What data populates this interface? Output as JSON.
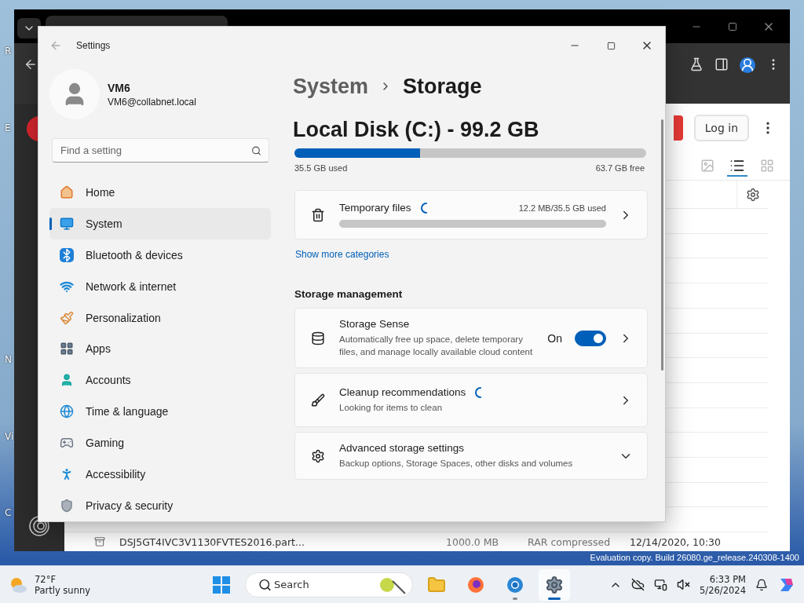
{
  "desktop": {
    "icon_labels": [
      "R",
      "E",
      "N",
      "Vi",
      "C"
    ],
    "build_text": "Evaluation copy. Build 26080.ge_release.240308-1400"
  },
  "browser": {
    "login_button": "Log in",
    "views": [
      {
        "kind": "thumbnail",
        "selected": false
      },
      {
        "kind": "list",
        "selected": true
      },
      {
        "kind": "grid",
        "selected": false
      }
    ],
    "file_row": {
      "name": "DSJ5GT4IVC3V1130FVTES2016.part...",
      "size": "1000.0 MB",
      "type": "RAR compressed",
      "date": "12/14/2020, 10:30"
    }
  },
  "settings": {
    "title": "Settings",
    "user": {
      "name": "VM6",
      "email": "VM6@collabnet.local"
    },
    "search": {
      "placeholder": "Find a setting"
    },
    "nav": [
      {
        "kind": "home",
        "label": "Home",
        "selected": false
      },
      {
        "kind": "system",
        "label": "System",
        "selected": true
      },
      {
        "kind": "bluetooth",
        "label": "Bluetooth & devices",
        "selected": false
      },
      {
        "kind": "network",
        "label": "Network & internet",
        "selected": false
      },
      {
        "kind": "personalization",
        "label": "Personalization",
        "selected": false
      },
      {
        "kind": "apps",
        "label": "Apps",
        "selected": false
      },
      {
        "kind": "accounts",
        "label": "Accounts",
        "selected": false
      },
      {
        "kind": "time",
        "label": "Time & language",
        "selected": false
      },
      {
        "kind": "gaming",
        "label": "Gaming",
        "selected": false
      },
      {
        "kind": "accessibility",
        "label": "Accessibility",
        "selected": false
      },
      {
        "kind": "privacy",
        "label": "Privacy & security",
        "selected": false
      }
    ],
    "breadcrumb": [
      "System",
      "Storage"
    ],
    "disk": {
      "title": "Local Disk (C:) - 99.2 GB",
      "level": 0.358,
      "used": "35.5 GB used",
      "free": "63.7 GB free"
    },
    "temp_files": {
      "label": "Temporary files",
      "loading": true,
      "usage": "12.2 MB/35.5 GB used",
      "level": 0
    },
    "more_link": "Show more categories",
    "section_title": "Storage management",
    "cards": [
      {
        "kind": "toggle",
        "title": "Storage Sense",
        "loading": false,
        "description": "Automatically free up space, delete temporary files, and manage locally available cloud content",
        "state_label": "On",
        "on": true
      },
      {
        "kind": "link",
        "title": "Cleanup recommendations",
        "loading": true,
        "description": "Looking for items to clean"
      },
      {
        "kind": "expander",
        "title": "Advanced storage settings",
        "loading": false,
        "description": "Backup options, Storage Spaces, other disks and volumes",
        "expanded": false
      }
    ]
  },
  "taskbar": {
    "weather": {
      "temp": "72°F",
      "condition": "Partly sunny"
    },
    "search": {
      "placeholder": "Search"
    },
    "apps": [
      {
        "kind": "files",
        "running": false,
        "focused": false
      },
      {
        "kind": "firefox",
        "running": false,
        "focused": false
      },
      {
        "kind": "chrome",
        "running": true,
        "focused": false
      },
      {
        "kind": "settings",
        "running": true,
        "focused": true
      }
    ],
    "clock": {
      "time": "6:33 PM",
      "date": "5/26/2024"
    }
  }
}
